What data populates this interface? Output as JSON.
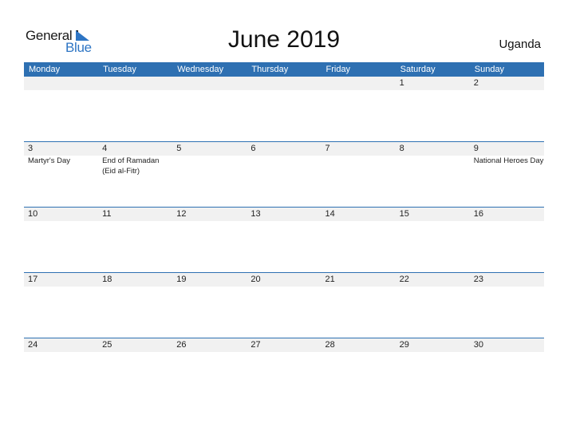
{
  "logo": {
    "word1": "General",
    "word2": "Blue"
  },
  "title": "June 2019",
  "country": "Uganda",
  "weekdays": [
    "Monday",
    "Tuesday",
    "Wednesday",
    "Thursday",
    "Friday",
    "Saturday",
    "Sunday"
  ],
  "weeks": [
    {
      "days": [
        {
          "num": "",
          "event": ""
        },
        {
          "num": "",
          "event": ""
        },
        {
          "num": "",
          "event": ""
        },
        {
          "num": "",
          "event": ""
        },
        {
          "num": "",
          "event": ""
        },
        {
          "num": "1",
          "event": ""
        },
        {
          "num": "2",
          "event": ""
        }
      ]
    },
    {
      "days": [
        {
          "num": "3",
          "event": "Martyr's Day"
        },
        {
          "num": "4",
          "event": "End of Ramadan (Eid al-Fitr)"
        },
        {
          "num": "5",
          "event": ""
        },
        {
          "num": "6",
          "event": ""
        },
        {
          "num": "7",
          "event": ""
        },
        {
          "num": "8",
          "event": ""
        },
        {
          "num": "9",
          "event": "National Heroes Day"
        }
      ]
    },
    {
      "days": [
        {
          "num": "10",
          "event": ""
        },
        {
          "num": "11",
          "event": ""
        },
        {
          "num": "12",
          "event": ""
        },
        {
          "num": "13",
          "event": ""
        },
        {
          "num": "14",
          "event": ""
        },
        {
          "num": "15",
          "event": ""
        },
        {
          "num": "16",
          "event": ""
        }
      ]
    },
    {
      "days": [
        {
          "num": "17",
          "event": ""
        },
        {
          "num": "18",
          "event": ""
        },
        {
          "num": "19",
          "event": ""
        },
        {
          "num": "20",
          "event": ""
        },
        {
          "num": "21",
          "event": ""
        },
        {
          "num": "22",
          "event": ""
        },
        {
          "num": "23",
          "event": ""
        }
      ]
    },
    {
      "days": [
        {
          "num": "24",
          "event": ""
        },
        {
          "num": "25",
          "event": ""
        },
        {
          "num": "26",
          "event": ""
        },
        {
          "num": "27",
          "event": ""
        },
        {
          "num": "28",
          "event": ""
        },
        {
          "num": "29",
          "event": ""
        },
        {
          "num": "30",
          "event": ""
        }
      ]
    }
  ],
  "colors": {
    "accent": "#2e70b2",
    "logo_blue": "#2e75c4",
    "band": "#f1f1f1"
  }
}
